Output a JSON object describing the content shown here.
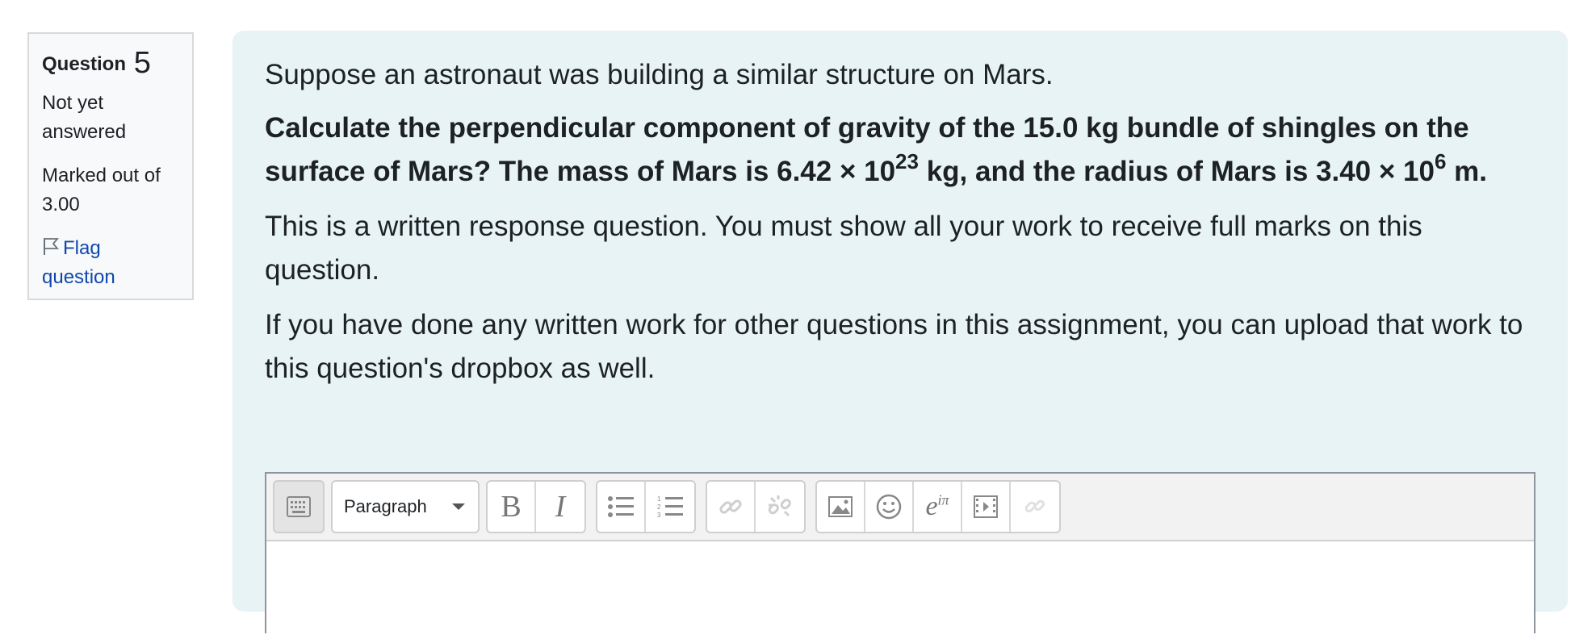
{
  "info": {
    "question_label": "Question",
    "question_number": "5",
    "state": "Not yet answered",
    "grade": "Marked out of 3.00",
    "flag_label": "Flag question"
  },
  "question": {
    "intro": "Suppose an astronaut was building a similar structure on Mars.",
    "bold_part1": "Calculate the perpendicular component of gravity of the 15.0 kg bundle of shingles on the surface of Mars? The mass of Mars is 6.42 × 10",
    "sup1": "23",
    "bold_part2": " kg, and the radius of Mars is 3.40 × 10",
    "sup2": "6",
    "bold_part3": " m.",
    "instruction": "This is a written response question.  You must show all your work to receive full marks on this question.",
    "upload_note": "If you have done any written work for other questions in this assignment, you can upload that work to this question's dropbox as well."
  },
  "editor": {
    "paragraph_select": "Paragraph",
    "icons": [
      "toolbar-toggle-icon",
      "bold-icon",
      "italic-icon",
      "bullet-list-icon",
      "numbered-list-icon",
      "link-icon",
      "unlink-icon",
      "image-icon",
      "emoji-icon",
      "equation-icon",
      "media-icon",
      "manage-files-icon"
    ],
    "bold_glyph": "B",
    "italic_glyph": "I",
    "equation_glyph": "e",
    "equation_sup": "iπ"
  }
}
